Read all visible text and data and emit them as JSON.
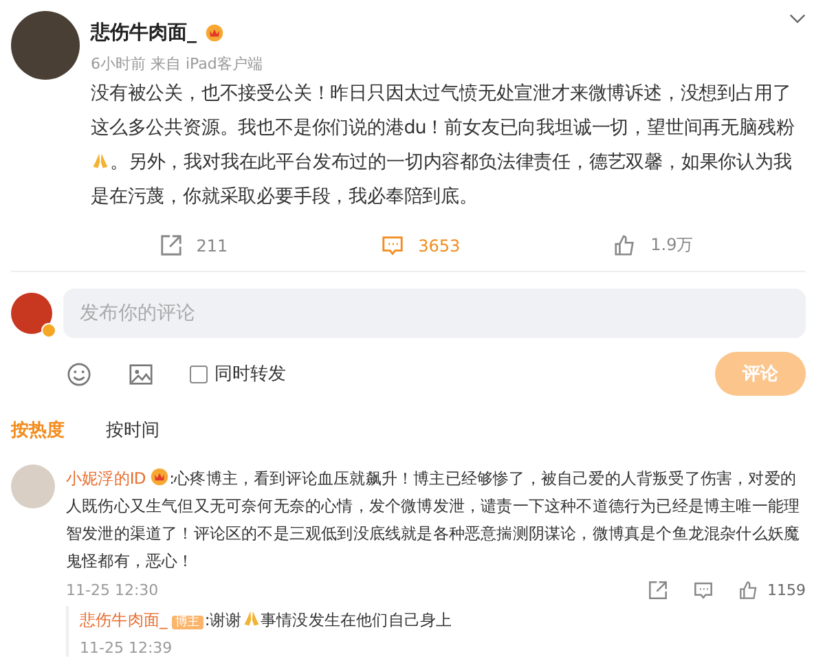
{
  "post": {
    "author": "悲伤牛肉面_",
    "meta": "6小时前  来自 iPad客户端",
    "body": [
      {
        "kind": "text",
        "text": "没有被公关，也不接受公关！昨日只因太过气愤无处宣泄才来微博诉述，没想到占用了"
      },
      {
        "kind": "text",
        "text": "这么多公共资源。我也不是你们说的港du！前女友已向我坦诚一切，望世间再无脑残粉"
      },
      {
        "kind": "emoji_text",
        "text": "。另外，我对我在此平台发布过的一切内容都负法律责任，德艺双馨，如果你认为我"
      },
      {
        "kind": "text",
        "text": "是在污蔑，你就采取必要手段，我必奉陪到底。"
      }
    ],
    "reposts": "211",
    "comments": "3653",
    "likes": "1.9万"
  },
  "composer": {
    "placeholder": "发布你的评论",
    "repost_label": "同时转发",
    "repost_checked": false,
    "submit": "评论"
  },
  "sort_tabs": [
    {
      "label": "按热度",
      "selected": true
    },
    {
      "label": "按时间",
      "selected": false
    }
  ],
  "comments": [
    {
      "user": "小妮浮的ID",
      "text_lines": [
        ":心疼博主，看到评论血压就飙升！博主已经够惨了，被自己爱的人背叛受了伤害，对爱的",
        "人既伤心又生气但又无可奈何无奈的心情，发个微博发泄，谴责一下这种不道德行为已经是博主唯一能理",
        "智发泄的渠道了！评论区的不是三观低到没底线就是各种恶意揣测阴谋论，微博真是个鱼龙混杂什么妖魔",
        "鬼怪都有，恶心！"
      ],
      "time": "11-25 12:30",
      "likes": "1159",
      "replies": [
        {
          "user": "悲伤牛肉面_",
          "tag": "博主",
          "before": ":谢谢",
          "after": "事情没发生在他们自己身上",
          "time": "11-25 12:39"
        }
      ]
    }
  ]
}
